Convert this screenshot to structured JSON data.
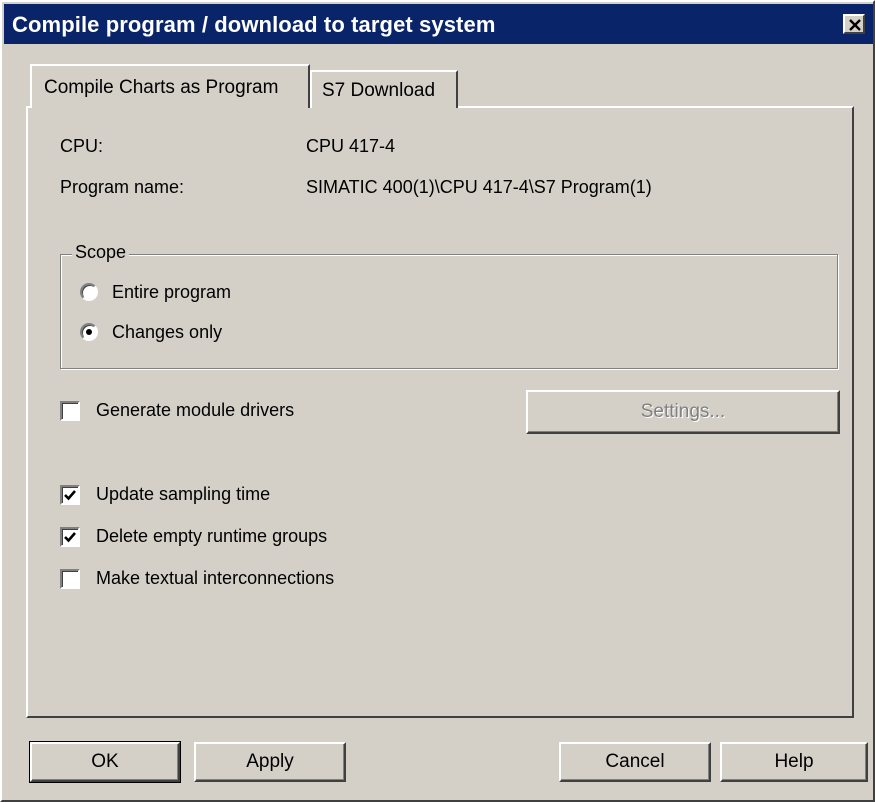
{
  "window": {
    "title": "Compile program / download to target system"
  },
  "tabs": [
    {
      "label": "Compile Charts as Program",
      "active": true
    },
    {
      "label": "S7 Download",
      "active": false
    }
  ],
  "info": {
    "cpu_label": "CPU:",
    "cpu_value": "CPU 417-4",
    "program_label": "Program name:",
    "program_value": "SIMATIC 400(1)\\CPU 417-4\\S7 Program(1)"
  },
  "scope": {
    "legend": "Scope",
    "options": [
      {
        "label": "Entire program",
        "selected": false
      },
      {
        "label": "Changes only",
        "selected": true
      }
    ]
  },
  "options": {
    "generate_module_drivers": {
      "label": "Generate module drivers",
      "checked": false
    },
    "settings_button": "Settings...",
    "update_sampling_time": {
      "label": "Update sampling time",
      "checked": true
    },
    "delete_empty_runtime_groups": {
      "label": "Delete empty runtime groups",
      "checked": true
    },
    "make_textual_interconnections": {
      "label": "Make textual interconnections",
      "checked": false
    }
  },
  "buttons": {
    "ok": "OK",
    "apply": "Apply",
    "cancel": "Cancel",
    "help": "Help"
  }
}
